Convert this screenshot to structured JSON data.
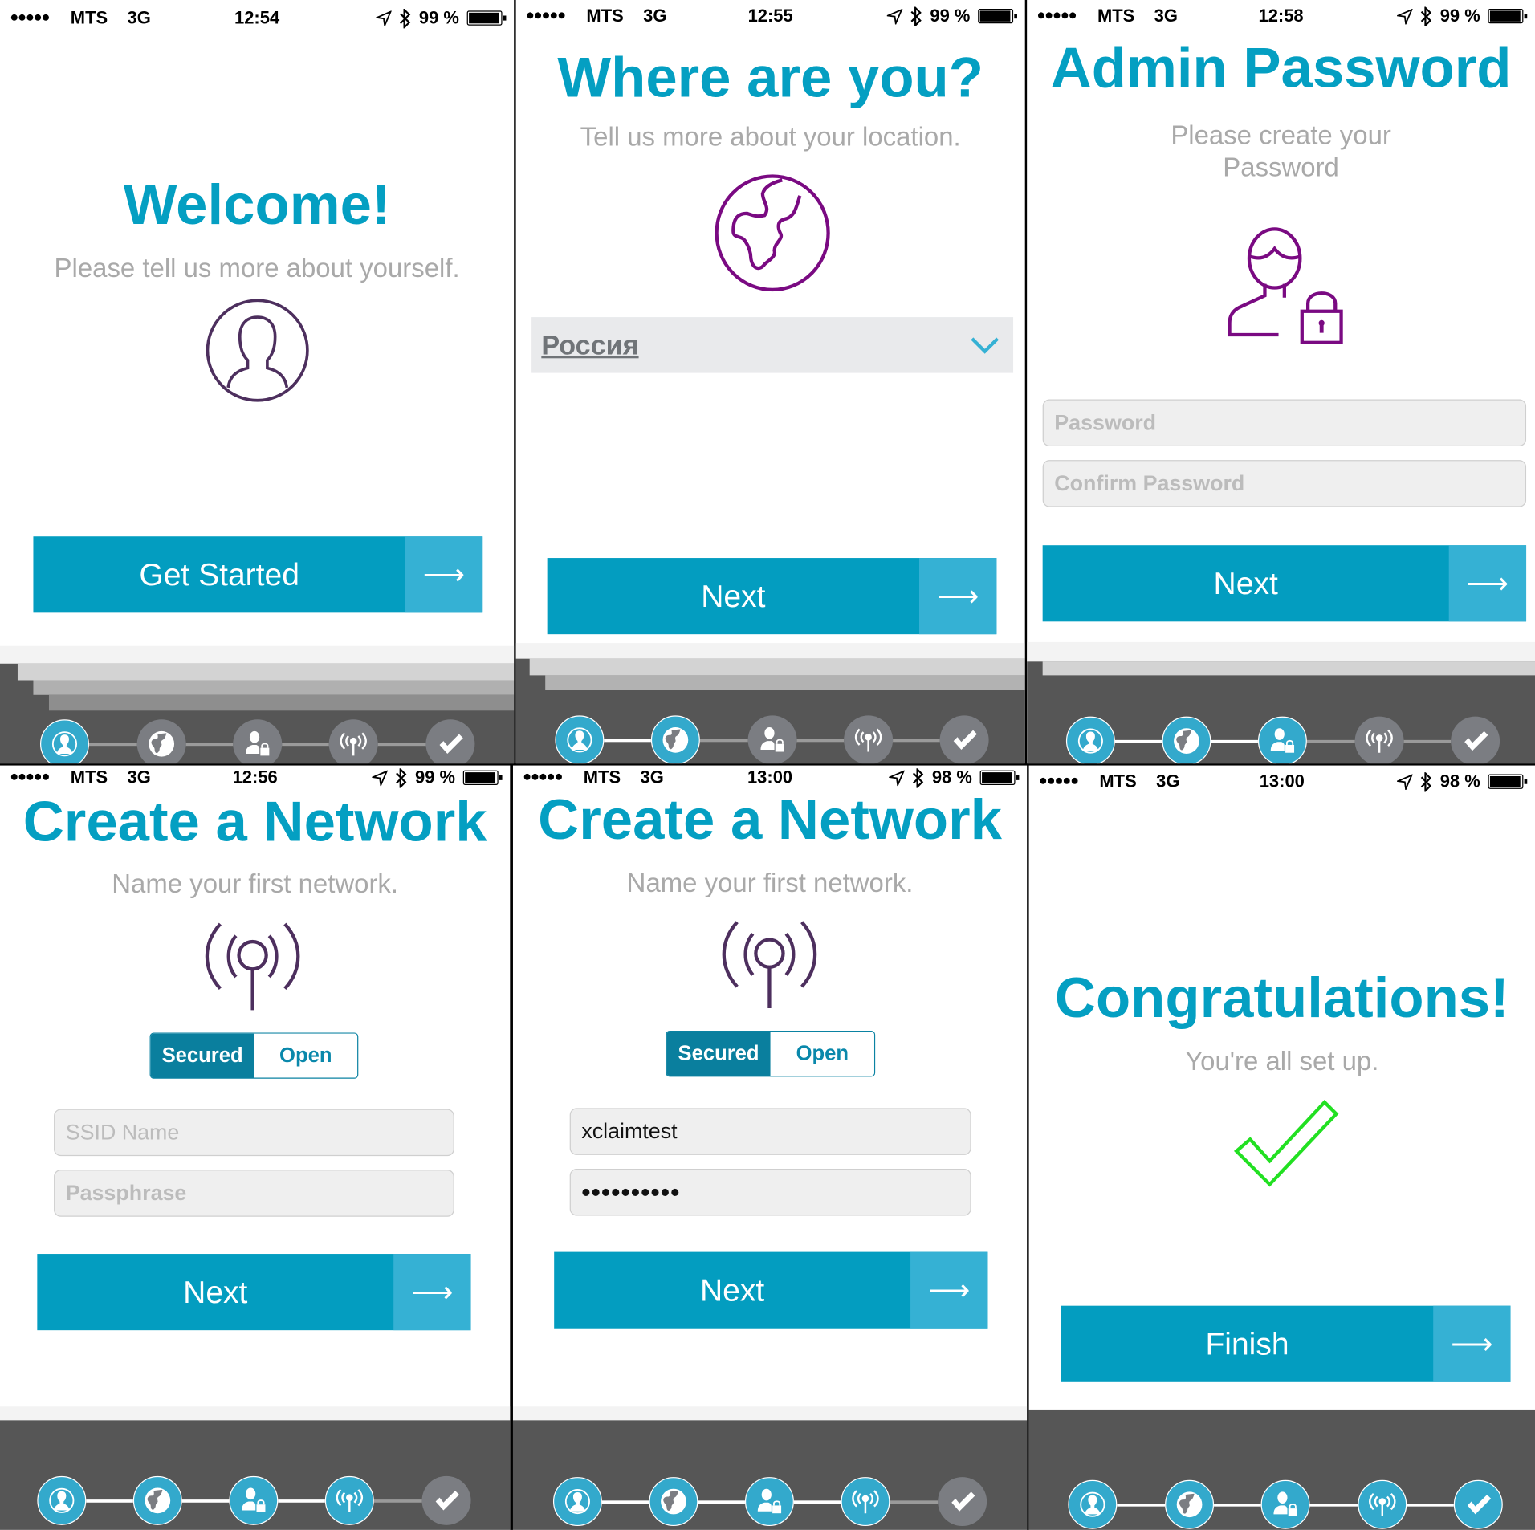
{
  "colors": {
    "accent": "#039dc0",
    "accent_light": "#35b1d4",
    "purple": "#7a0a82",
    "dark_purple": "#4d2f5e",
    "step_active": "#33a9cc",
    "step_inactive": "#7b7d82",
    "success": "#22e022"
  },
  "step_icons": [
    "person-icon",
    "globe-icon",
    "user-lock-icon",
    "antenna-icon",
    "check-icon"
  ],
  "screens": [
    {
      "status": {
        "carrier": "MTS",
        "network": "3G",
        "time": "12:54",
        "battery": "99 %"
      },
      "title": "Welcome!",
      "subtitle": "Please tell us more about yourself.",
      "button": "Get Started",
      "arrow": "⟶",
      "active_steps": 1
    },
    {
      "status": {
        "carrier": "MTS",
        "network": "3G",
        "time": "12:55",
        "battery": "99 %"
      },
      "title": "Where are you?",
      "subtitle": "Tell us more about your location.",
      "country_select": {
        "value": "Россия"
      },
      "button": "Next",
      "arrow": "⟶",
      "active_steps": 2
    },
    {
      "status": {
        "carrier": "MTS",
        "network": "3G",
        "time": "12:58",
        "battery": "99 %"
      },
      "title": "Admin Password",
      "subtitle_line1": "Please create your",
      "subtitle_line2": "Password",
      "password_placeholder": "Password",
      "confirm_placeholder": "Confirm Password",
      "button": "Next",
      "arrow": "⟶",
      "active_steps": 3
    },
    {
      "status": {
        "carrier": "MTS",
        "network": "3G",
        "time": "12:56",
        "battery": "99 %"
      },
      "title": "Create a Network",
      "subtitle": "Name your first network.",
      "segments": [
        "Secured",
        "Open"
      ],
      "selected_segment": "Secured",
      "ssid_placeholder": "SSID Name",
      "passphrase_placeholder": "Passphrase",
      "button": "Next",
      "arrow": "⟶",
      "active_steps": 4
    },
    {
      "status": {
        "carrier": "MTS",
        "network": "3G",
        "time": "13:00",
        "battery": "98 %"
      },
      "title": "Create a Network",
      "subtitle": "Name your first network.",
      "segments": [
        "Secured",
        "Open"
      ],
      "selected_segment": "Secured",
      "ssid_value": "xclaimtest",
      "passphrase_value": "••••••••••",
      "button": "Next",
      "arrow": "⟶",
      "active_steps": 4
    },
    {
      "status": {
        "carrier": "MTS",
        "network": "3G",
        "time": "13:00",
        "battery": "98 %"
      },
      "title": "Congratulations!",
      "subtitle": "You're all set up.",
      "button": "Finish",
      "arrow": "⟶",
      "active_steps": 5
    }
  ]
}
